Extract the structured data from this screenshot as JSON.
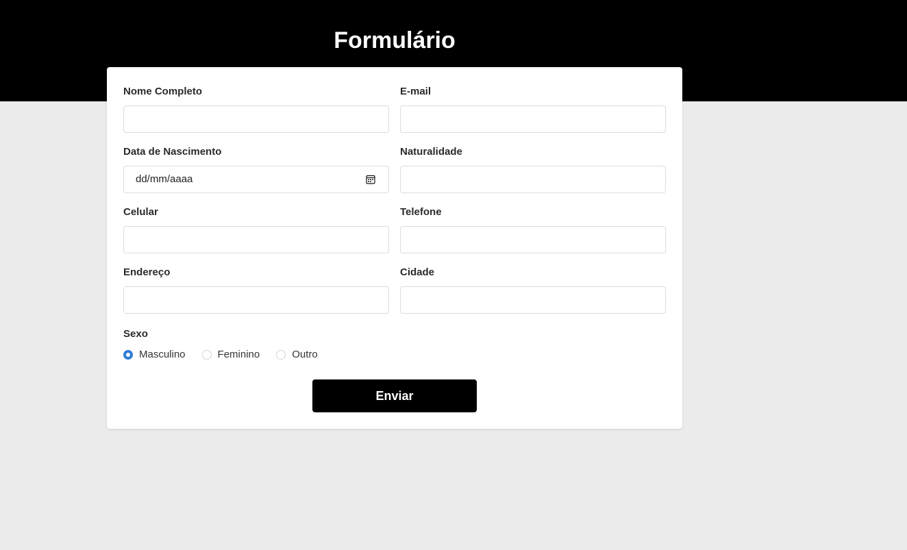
{
  "header": {
    "title": "Formulário"
  },
  "form": {
    "fields": {
      "nome": {
        "label": "Nome Completo",
        "value": ""
      },
      "email": {
        "label": "E-mail",
        "value": ""
      },
      "nascimento": {
        "label": "Data de Nascimento",
        "placeholder": "dd/mm/aaaa"
      },
      "naturalidade": {
        "label": "Naturalidade",
        "value": ""
      },
      "celular": {
        "label": "Celular",
        "value": ""
      },
      "telefone": {
        "label": "Telefone",
        "value": ""
      },
      "endereco": {
        "label": "Endereço",
        "value": ""
      },
      "cidade": {
        "label": "Cidade",
        "value": ""
      }
    },
    "sexo": {
      "label": "Sexo",
      "options": [
        "Masculino",
        "Feminino",
        "Outro"
      ],
      "selected": "Masculino"
    },
    "submit_label": "Enviar"
  },
  "colors": {
    "header_bg": "#000000",
    "page_bg": "#ebebeb",
    "radio_accent": "#2f7ed8",
    "button_bg": "#000000"
  },
  "icons": {
    "date_picker": "calendar-icon"
  }
}
